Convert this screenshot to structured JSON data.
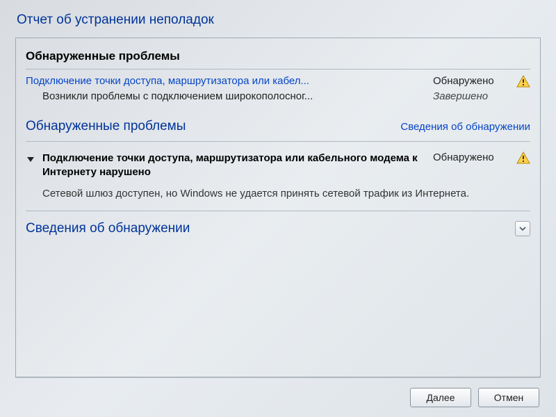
{
  "window": {
    "title": "Отчет об устранении неполадок"
  },
  "issues_found": {
    "heading": "Обнаруженные проблемы",
    "items": [
      {
        "label": "Подключение точки доступа, маршрутизатора или кабел...",
        "status": "Обнаружено",
        "sub_label": "Возникли проблемы с подключением широкополосног...",
        "sub_status": "Завершено"
      }
    ]
  },
  "issues_section": {
    "heading": "Обнаруженные проблемы",
    "detection_link": "Сведения об обнаружении"
  },
  "expanded_issue": {
    "title": "Подключение точки доступа, маршрутизатора или кабельного модема к Интернету нарушено",
    "status": "Обнаружено",
    "description": "Сетевой шлюз доступен, но Windows не удается принять сетевой трафик из Интернета."
  },
  "detection_info": {
    "heading": "Сведения об обнаружении"
  },
  "buttons": {
    "next": "Далее",
    "cancel": "Отмен"
  }
}
